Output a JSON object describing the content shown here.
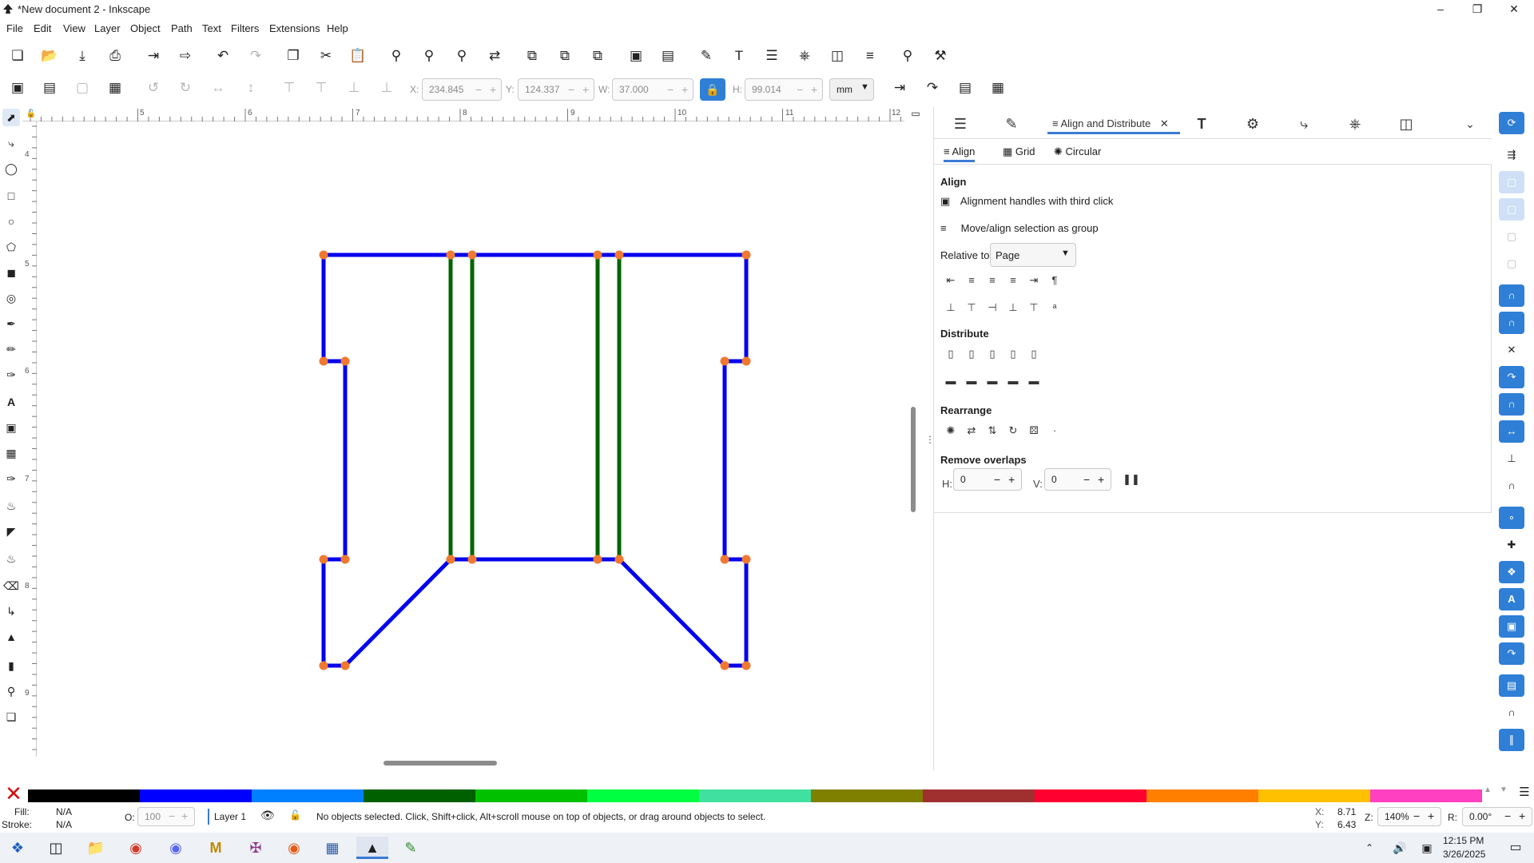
{
  "window": {
    "title": "*New document 2 - Inkscape"
  },
  "menu": [
    "File",
    "Edit",
    "View",
    "Layer",
    "Object",
    "Path",
    "Text",
    "Filters",
    "Extensions",
    "Help"
  ],
  "tool_controls": {
    "x_label": "X:",
    "x_value": "234.845",
    "y_label": "Y:",
    "y_value": "124.337",
    "w_label": "W:",
    "w_value": "37.000",
    "h_label": "H:",
    "h_value": "99.014",
    "unit": "mm"
  },
  "ruler_numbers": [
    "5",
    "6",
    "7",
    "8",
    "9",
    "10",
    "11",
    "12"
  ],
  "vruler_numbers": [
    "4",
    "5",
    "6",
    "7",
    "8",
    "9"
  ],
  "dock": {
    "active_tab": "Align and Distribute",
    "subtabs": [
      "Align",
      "Grid",
      "Circular"
    ],
    "align_heading": "Align",
    "option_handles": "Alignment handles with third click",
    "option_group": "Move/align selection as group",
    "relative_label": "Relative to:",
    "relative_value": "Page",
    "distribute_heading": "Distribute",
    "rearrange_heading": "Rearrange",
    "remove_overlaps_heading": "Remove overlaps",
    "h_label": "H:",
    "h_value": "0",
    "v_label": "V:",
    "v_value": "0"
  },
  "palette_colors": [
    "#000000",
    "#0000ff",
    "#0080ff",
    "#006000",
    "#00c000",
    "#00ff40",
    "#40e0a0",
    "#808000",
    "#a03030",
    "#ff0030",
    "#ff8000",
    "#ffc000",
    "#ff40c0"
  ],
  "status": {
    "fill_label": "Fill:",
    "fill_value": "N/A",
    "stroke_label": "Stroke:",
    "stroke_value": "N/A",
    "opacity_label": "O:",
    "opacity_value": "100",
    "layer": "Layer 1",
    "message": "No objects selected. Click, Shift+click, Alt+scroll mouse on top of objects, or drag around objects to select.",
    "x_label": "X:",
    "x_value": "8.71",
    "y_label": "Y:",
    "y_value": "6.43",
    "zoom_label": "Z:",
    "zoom_value": "140%",
    "rotation_label": "R:",
    "rotation_value": "0.00°"
  },
  "taskbar": {
    "time": "12:15 PM",
    "date": "3/26/2025"
  },
  "colors": {
    "outline": "#0000ee",
    "inner": "#006400",
    "node": "#f07830",
    "accent": "#2f7fd6"
  }
}
